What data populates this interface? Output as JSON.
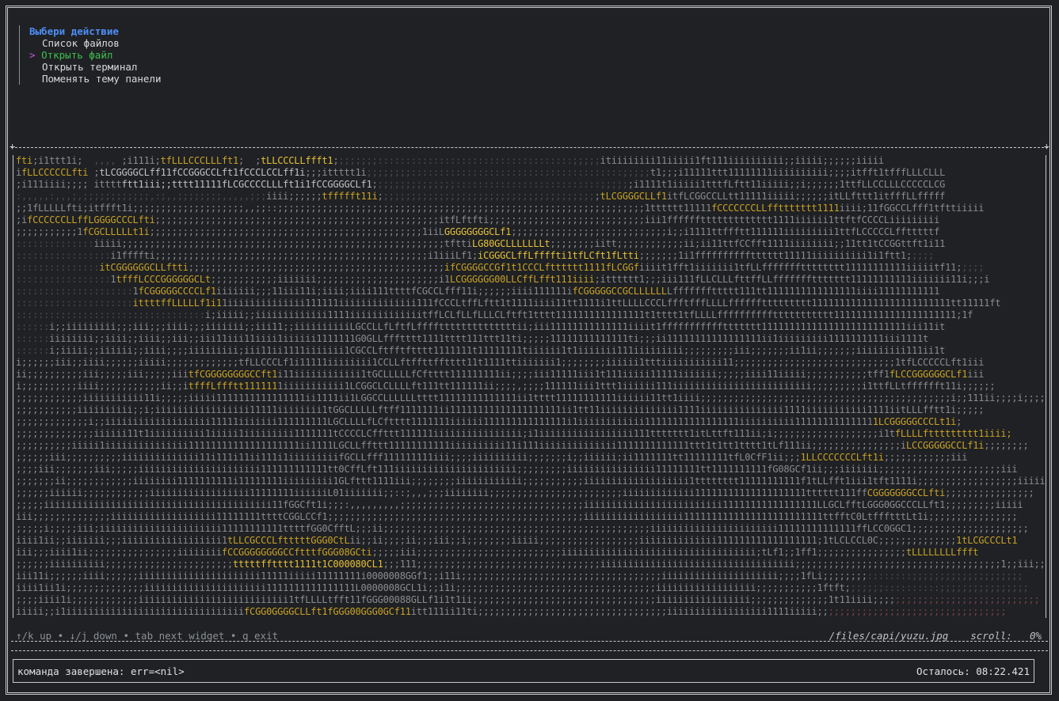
{
  "menu": {
    "title": "Выбери действие",
    "cursor": ">",
    "items": [
      {
        "label": "Список файлов"
      },
      {
        "label": "Открыть файл"
      },
      {
        "label": "Открыть терминал"
      },
      {
        "label": "Поменять тему панели"
      }
    ],
    "selected_index": 1
  },
  "viewer": {
    "help": "↑/k up • ↓/j down • tab next widget • q exit",
    "file_path": "/files/capi/yuzu.jpg",
    "scroll_label": "scroll:",
    "scroll_value": "0%"
  },
  "status": {
    "message": "команда завершена: err=<nil>",
    "remaining": "Осталось: 08:22.421"
  },
  "colors": {
    "accent_blue": "#4e8ef7",
    "selected_green": "#3fbf4e",
    "cursor_purple": "#c15ad9",
    "art_yellow": "#e7c13a"
  }
}
